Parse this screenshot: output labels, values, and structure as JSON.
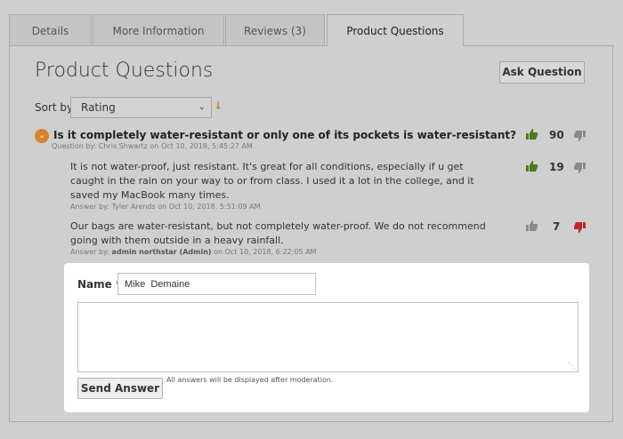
{
  "tabs": [
    {
      "label": "Details"
    },
    {
      "label": "More Information"
    },
    {
      "label": "Reviews (3)"
    },
    {
      "label": "Product Questions"
    }
  ],
  "page": {
    "title": "Product Questions",
    "ask_button": "Ask Question"
  },
  "sort": {
    "label": "Sort by",
    "selected": "Rating",
    "direction_icon": "arrow-down-icon"
  },
  "question": {
    "text": "Is it completely water-resistant or only one of its pockets is water-resistant?",
    "meta": "Question by: Chris Shwartz on Oct 10, 2018, 5:45:27 AM",
    "votes": "90"
  },
  "answers": [
    {
      "text": "It is not water-proof, just resistant. It's great for all conditions, especially if u get caught in the rain on your way to or from class. I used it a lot in the college, and it saved my MacBook many times.",
      "meta": "Answer by: Tyler Arends on Oct 10, 2018, 5:51:09 AM",
      "votes": "19"
    },
    {
      "text": "Our bags are water-resistant, but not completely water-proof. We do not recommend going with them outside in a heavy rainfall.",
      "meta_prefix": "Answer by: ",
      "meta_author": "admin northstar (Admin)",
      "meta_suffix": " on Oct 10, 2018, 6:22:05 AM",
      "votes": "7"
    }
  ],
  "form": {
    "name_label": "Name",
    "required_mark": "*",
    "name_value": "Mike  Demaine",
    "send_button": "Send Answer",
    "moderation_note": "All answers will be displayed after moderation."
  },
  "colors": {
    "accent": "#d9822b",
    "thumb_up": "#4a7a1c",
    "thumb_down_active": "#c0272d",
    "thumb_neutral": "#8a8a8a"
  }
}
